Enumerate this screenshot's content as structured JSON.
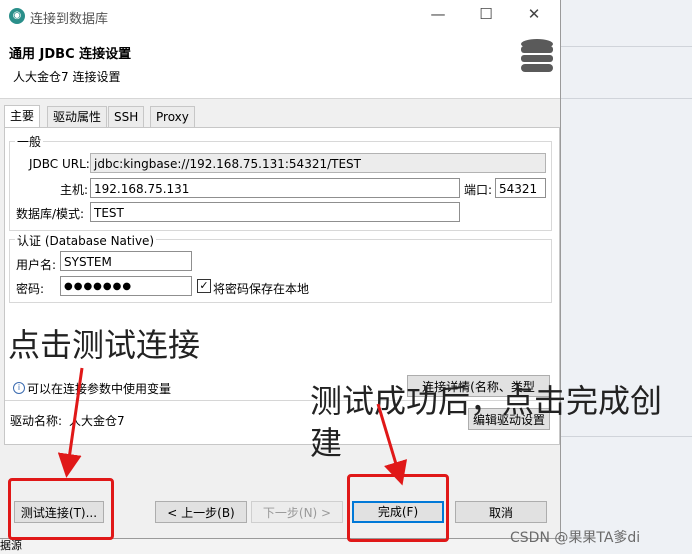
{
  "window": {
    "title": "连接到数据库",
    "minimize_glyph": "—",
    "maximize_glyph": "☐",
    "close_glyph": "✕",
    "app_icon": "dbeaver-logo-icon"
  },
  "header": {
    "title": "通用 JDBC 连接设置",
    "subtitle": "人大金仓7 连接设置",
    "icon": "database-icon"
  },
  "tabs": [
    {
      "label": "主要",
      "active": true
    },
    {
      "label": "驱动属性",
      "active": false
    },
    {
      "label": "SSH",
      "active": false
    },
    {
      "label": "Proxy",
      "active": false
    }
  ],
  "general": {
    "legend": "一般",
    "jdbc_url_label": "JDBC URL:",
    "jdbc_url_value": "jdbc:kingbase://192.168.75.131:54321/TEST",
    "host_label": "主机:",
    "host_value": "192.168.75.131",
    "port_label": "端口:",
    "port_value": "54321",
    "db_label": "数据库/模式:",
    "db_value": "TEST"
  },
  "auth": {
    "legend": "认证 (Database Native)",
    "user_label": "用户名:",
    "user_value": "SYSTEM",
    "password_label": "密码:",
    "password_value": "●●●●●●●",
    "save_password_label": "将密码保存在本地",
    "save_password_checked": true
  },
  "info_text": "可以在连接参数中使用变量",
  "conn_details_button": "连接详情(名称、类型",
  "driver": {
    "label": "驱动名称:",
    "value": "人大金仓7",
    "edit_button": "编辑驱动设置"
  },
  "buttons": {
    "test": "测试连接(T)...",
    "back": "< 上一步(B)",
    "next": "下一步(N) >",
    "finish": "完成(F)",
    "cancel": "取消"
  },
  "annotations": {
    "click_test": "点击测试连接",
    "after_success_line1": "测试成功后，点击完成创",
    "after_success_line2": "建",
    "color": "#e01818"
  },
  "background_fragment": "据源",
  "watermark": "CSDN @果果TA爹di"
}
